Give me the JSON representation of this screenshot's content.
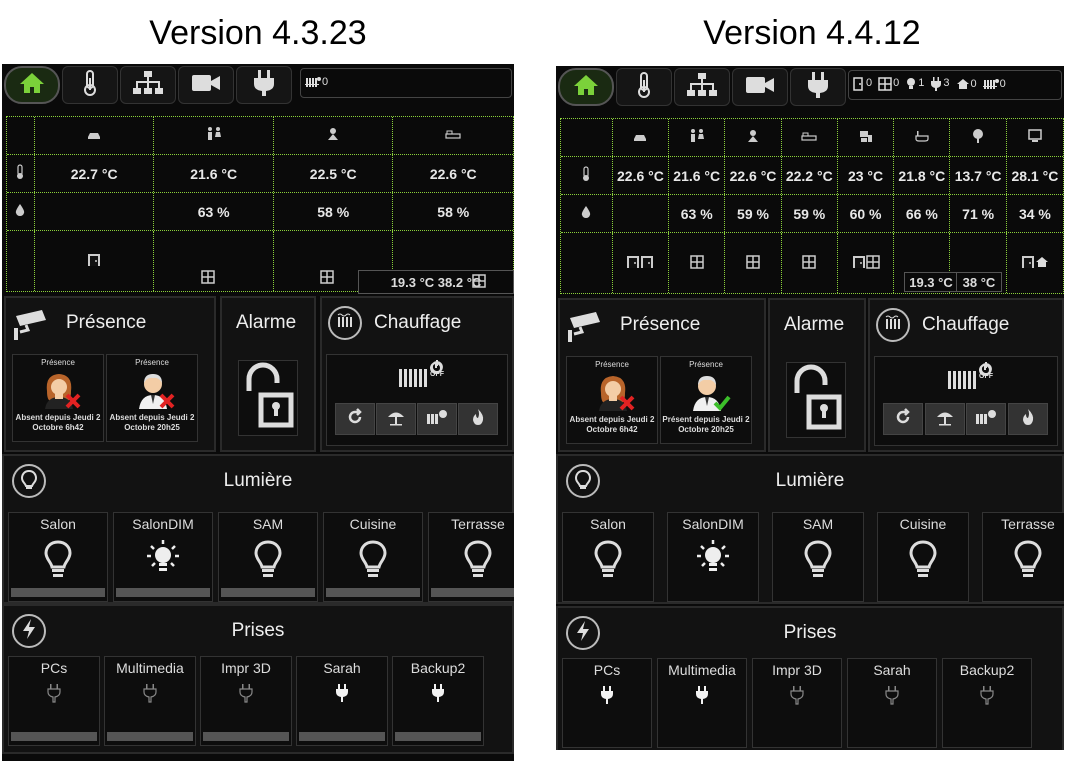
{
  "left": {
    "heading": "Version 4.3.23",
    "status_items": [
      {
        "icon": "radiator-icon",
        "count": "0"
      }
    ],
    "grid": {
      "rooms": [
        "car-icon",
        "couple-icon",
        "child-icon",
        "bed-icon"
      ],
      "temps": [
        "22.7 °C",
        "21.6 °C",
        "22.5 °C",
        "22.6 °C"
      ],
      "hums": [
        "",
        "63 %",
        "58 %",
        "58 %"
      ],
      "readout": "19.3 °C 38.2 °C"
    },
    "presence": {
      "title": "Présence",
      "people": [
        {
          "header": "Présence",
          "status": "Absent depuis Jeudi 2 Octobre 6h42",
          "gender": "female",
          "present": false
        },
        {
          "header": "Présence",
          "status": "Absent depuis Jeudi 2 Octobre 20h25",
          "gender": "male",
          "present": false
        }
      ]
    },
    "alarm": {
      "title": "Alarme"
    },
    "heating": {
      "title": "Chauffage",
      "state": "OFF"
    },
    "lights": {
      "title": "Lumière",
      "items": [
        {
          "label": "Salon",
          "on": false
        },
        {
          "label": "SalonDIM",
          "on": true
        },
        {
          "label": "SAM",
          "on": false
        },
        {
          "label": "Cuisine",
          "on": false
        },
        {
          "label": "Terrasse",
          "on": false
        }
      ]
    },
    "plugs": {
      "title": "Prises",
      "items": [
        {
          "label": "PCs",
          "on": false
        },
        {
          "label": "Multimedia",
          "on": false
        },
        {
          "label": "Impr 3D",
          "on": false
        },
        {
          "label": "Sarah",
          "on": true
        },
        {
          "label": "Backup2",
          "on": true
        }
      ]
    }
  },
  "right": {
    "heading": "Version 4.4.12",
    "status_items": [
      {
        "icon": "door-icon",
        "count": "0"
      },
      {
        "icon": "window-icon",
        "count": "0"
      },
      {
        "icon": "bulb-icon",
        "count": "1"
      },
      {
        "icon": "plug-icon",
        "count": "3"
      },
      {
        "icon": "house-icon",
        "count": "0"
      },
      {
        "icon": "radiator-icon",
        "count": "0"
      }
    ],
    "grid": {
      "rooms": [
        "car-icon",
        "couple-icon",
        "child-icon",
        "bed-icon",
        "office-icon",
        "bath-icon",
        "tree-icon",
        "monitor-icon"
      ],
      "temps": [
        "22.6 °C",
        "21.6 °C",
        "22.6 °C",
        "22.2 °C",
        "23 °C",
        "21.8 °C",
        "13.7 °C",
        "28.1 °C"
      ],
      "hums": [
        "",
        "63 %",
        "59 %",
        "59 %",
        "60 %",
        "66 %",
        "71 %",
        "34 %"
      ],
      "readout_a": "19.3 °C",
      "readout_b": "38 °C"
    },
    "presence": {
      "title": "Présence",
      "people": [
        {
          "header": "Présence",
          "status": "Absent depuis Jeudi 2 Octobre 6h42",
          "gender": "female",
          "present": false
        },
        {
          "header": "Présence",
          "status": "Présent depuis Jeudi 2 Octobre 20h25",
          "gender": "male",
          "present": true
        }
      ]
    },
    "alarm": {
      "title": "Alarme"
    },
    "heating": {
      "title": "Chauffage",
      "state": "OFF"
    },
    "lights": {
      "title": "Lumière",
      "items": [
        {
          "label": "Salon",
          "on": false
        },
        {
          "label": "SalonDIM",
          "on": true
        },
        {
          "label": "SAM",
          "on": false
        },
        {
          "label": "Cuisine",
          "on": false
        },
        {
          "label": "Terrasse",
          "on": false
        }
      ]
    },
    "plugs": {
      "title": "Prises",
      "items": [
        {
          "label": "PCs",
          "on": true
        },
        {
          "label": "Multimedia",
          "on": true
        },
        {
          "label": "Impr 3D",
          "on": false
        },
        {
          "label": "Sarah",
          "on": false
        },
        {
          "label": "Backup2",
          "on": false
        }
      ]
    }
  },
  "colors": {
    "grid_dots": "#8bd13a",
    "home_green": "#7bd13a",
    "cross_red": "#e22222",
    "check_green": "#3cbf2a"
  }
}
